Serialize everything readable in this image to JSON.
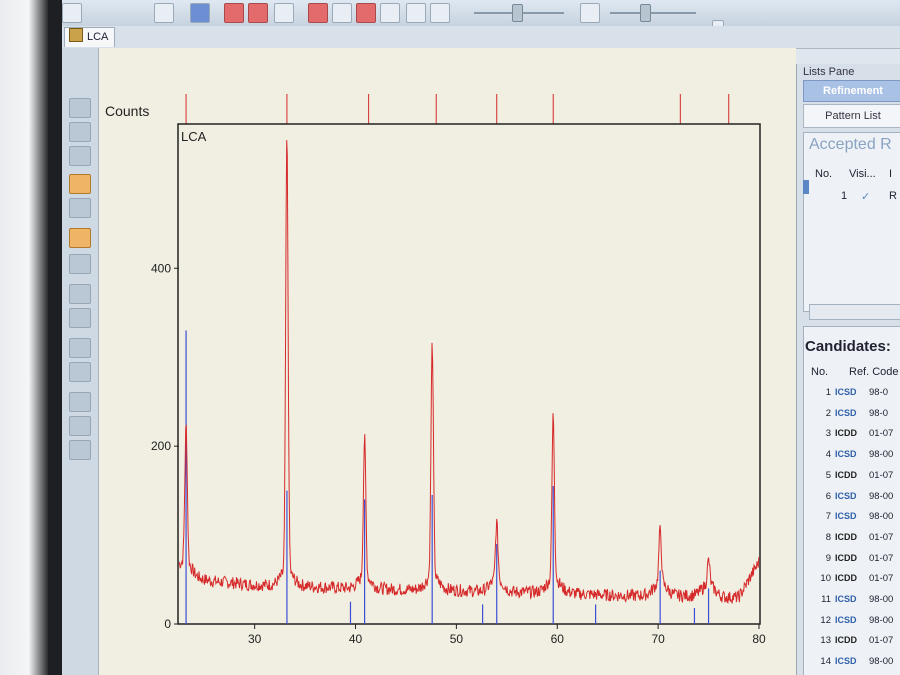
{
  "tab": {
    "label": "LCA"
  },
  "panel": {
    "lists_pane_title": "Lists Pane",
    "refine_btn": "Refinement",
    "pattern_list_btn": "Pattern List",
    "accepted_heading": "Accepted R",
    "accepted_cols": [
      "No.",
      "Visi...",
      "I"
    ],
    "accepted_row": {
      "no": "1",
      "visible": "✓",
      "extra": "R"
    },
    "candidates_heading": "Candidates:",
    "cand_cols": [
      "No.",
      "Ref. Code"
    ],
    "candidates": [
      {
        "no": "1",
        "db": "ICSD",
        "code": "98-0"
      },
      {
        "no": "2",
        "db": "ICSD",
        "code": "98-0"
      },
      {
        "no": "3",
        "db": "ICDD",
        "code": "01-07"
      },
      {
        "no": "4",
        "db": "ICSD",
        "code": "98-00"
      },
      {
        "no": "5",
        "db": "ICDD",
        "code": "01-07"
      },
      {
        "no": "6",
        "db": "ICSD",
        "code": "98-00"
      },
      {
        "no": "7",
        "db": "ICSD",
        "code": "98-00"
      },
      {
        "no": "8",
        "db": "ICDD",
        "code": "01-07"
      },
      {
        "no": "9",
        "db": "ICDD",
        "code": "01-07"
      },
      {
        "no": "10",
        "db": "ICDD",
        "code": "01-07"
      },
      {
        "no": "11",
        "db": "ICSD",
        "code": "98-00"
      },
      {
        "no": "12",
        "db": "ICSD",
        "code": "98-00"
      },
      {
        "no": "13",
        "db": "ICDD",
        "code": "01-07"
      },
      {
        "no": "14",
        "db": "ICSD",
        "code": "98-00"
      }
    ]
  },
  "colors": {
    "observed": "#d62a2a",
    "reference": "#3b4fd4",
    "plot_bg": "#f1eee2"
  },
  "chart_data": {
    "type": "line",
    "title": "LCA",
    "ylabel": "Counts",
    "xlabel": "",
    "xlim": [
      22.5,
      80
    ],
    "ylim": [
      0,
      560
    ],
    "x_ticks": [
      30,
      40,
      50,
      60,
      70,
      80
    ],
    "y_ticks": [
      0,
      200,
      400
    ],
    "grid": false,
    "series": [
      {
        "name": "",
        "color": "#d62a2a",
        "baseline": [
          [
            22.5,
            60
          ],
          [
            24,
            52
          ],
          [
            26,
            48
          ],
          [
            28,
            46
          ],
          [
            30,
            44
          ],
          [
            32,
            44
          ],
          [
            33,
            46
          ],
          [
            34,
            44
          ],
          [
            36,
            42
          ],
          [
            38,
            41
          ],
          [
            40,
            40
          ],
          [
            42,
            40
          ],
          [
            44,
            39
          ],
          [
            46,
            39
          ],
          [
            48,
            40
          ],
          [
            50,
            38
          ],
          [
            52,
            37
          ],
          [
            54,
            37
          ],
          [
            56,
            36
          ],
          [
            58,
            36
          ],
          [
            60,
            38
          ],
          [
            62,
            34
          ],
          [
            64,
            33
          ],
          [
            66,
            32
          ],
          [
            68,
            32
          ],
          [
            70,
            33
          ],
          [
            72,
            32
          ],
          [
            74,
            32
          ],
          [
            76,
            30
          ],
          [
            78,
            30
          ],
          [
            80,
            70
          ]
        ],
        "peaks": [
          {
            "x": 23.2,
            "y": 210
          },
          {
            "x": 33.2,
            "y": 535
          },
          {
            "x": 40.9,
            "y": 195
          },
          {
            "x": 47.6,
            "y": 302
          },
          {
            "x": 54.0,
            "y": 100
          },
          {
            "x": 59.6,
            "y": 222
          },
          {
            "x": 70.2,
            "y": 92
          },
          {
            "x": 75.0,
            "y": 58
          }
        ]
      },
      {
        "name": "",
        "color": "#3b4fd4",
        "sticks": [
          {
            "x": 23.2,
            "y": 330
          },
          {
            "x": 33.2,
            "y": 150
          },
          {
            "x": 40.9,
            "y": 140
          },
          {
            "x": 47.6,
            "y": 145
          },
          {
            "x": 54.0,
            "y": 90
          },
          {
            "x": 59.6,
            "y": 155
          },
          {
            "x": 70.2,
            "y": 60
          },
          {
            "x": 75.0,
            "y": 40
          },
          {
            "x": 39.5,
            "y": 25
          },
          {
            "x": 52.6,
            "y": 22
          },
          {
            "x": 63.8,
            "y": 22
          },
          {
            "x": 73.6,
            "y": 18
          }
        ]
      }
    ],
    "top_markers": [
      23.2,
      33.2,
      41.3,
      48.0,
      54.0,
      59.6,
      72.2,
      77.0
    ]
  }
}
